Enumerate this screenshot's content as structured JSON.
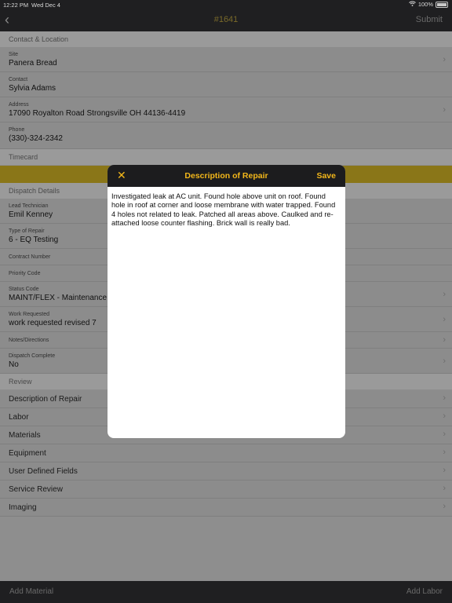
{
  "status": {
    "time": "12:22 PM",
    "date": "Wed Dec 4",
    "battery": "100%"
  },
  "nav": {
    "back": "‹",
    "title": "#1641",
    "submit": "Submit"
  },
  "sections": {
    "contact": "Contact & Location",
    "timecard": "Timecard",
    "dispatch": "Dispatch Details",
    "review": "Review"
  },
  "contact": {
    "site_label": "Site",
    "site": "Panera Bread",
    "contact_label": "Contact",
    "contact": "Sylvia Adams",
    "address_label": "Address",
    "address": "17090 Royalton Road  Strongsville OH 44136-4419",
    "phone_label": "Phone",
    "phone": "(330)-324-2342"
  },
  "dispatch": {
    "lead_label": "Lead Technician",
    "lead": "Emil Kenney",
    "type_label": "Type of Repair",
    "type": "6 - EQ Testing",
    "contract_label": "Contract Number",
    "priority_label": "Priority Code",
    "status_label": "Status Code",
    "status": "MAINT/FLEX - Maintenance",
    "work_label": "Work Requested",
    "work": "work requested revised 7",
    "notes_label": "Notes/Directions",
    "complete_label": "Dispatch Complete",
    "complete": "No"
  },
  "review_items": [
    "Description of Repair",
    "Labor",
    "Materials",
    "Equipment",
    "User Defined Fields",
    "Service Review",
    "Imaging"
  ],
  "bottom": {
    "left": "Add Material",
    "right": "Add Labor"
  },
  "modal": {
    "close": "✕",
    "title": "Description of Repair",
    "save": "Save",
    "text": "Investigated leak at AC unit. Found hole above unit on roof. Found hole in roof at corner and loose membrane with water trapped. Found 4 holes not related to leak. Patched all areas above. Caulked and re-attached loose counter flashing. Brick wall is really bad."
  },
  "colors": {
    "accent": "#f3b71a",
    "bar": "#1f1f21"
  }
}
